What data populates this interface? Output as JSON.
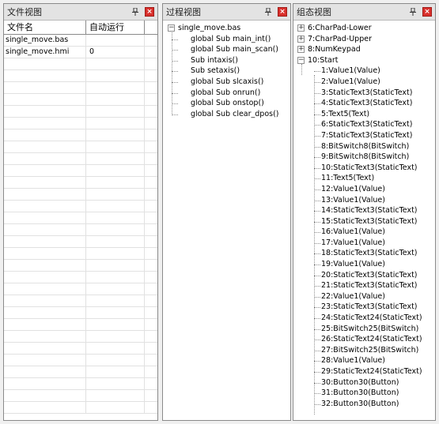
{
  "file_view": {
    "title": "文件视图",
    "columns": [
      "文件名",
      "自动运行"
    ],
    "rows": [
      {
        "name": "single_move.bas",
        "autorun": ""
      },
      {
        "name": "single_move.hmi",
        "autorun": "0"
      }
    ]
  },
  "process_view": {
    "title": "过程视图",
    "root": "single_move.bas",
    "items": [
      "global Sub main_int()",
      "global Sub main_scan()",
      "Sub intaxis()",
      "Sub setaxis()",
      "global Sub slcaxis()",
      "global Sub onrun()",
      "global Sub onstop()",
      "global Sub clear_dpos()"
    ]
  },
  "component_view": {
    "title": "组态视图",
    "collapsed": [
      "6:CharPad-Lower",
      "7:CharPad-Upper",
      "8:NumKeypad"
    ],
    "expanded_root": "10:Start",
    "children": [
      "1:Value1(Value)",
      "2:Value1(Value)",
      "3:StaticText3(StaticText)",
      "4:StaticText3(StaticText)",
      "5:Text5(Text)",
      "6:StaticText3(StaticText)",
      "7:StaticText3(StaticText)",
      "8:BitSwitch8(BitSwitch)",
      "9:BitSwitch8(BitSwitch)",
      "10:StaticText3(StaticText)",
      "11:Text5(Text)",
      "12:Value1(Value)",
      "13:Value1(Value)",
      "14:StaticText3(StaticText)",
      "15:StaticText3(StaticText)",
      "16:Value1(Value)",
      "17:Value1(Value)",
      "18:StaticText3(StaticText)",
      "19:Value1(Value)",
      "20:StaticText3(StaticText)",
      "21:StaticText3(StaticText)",
      "22:Value1(Value)",
      "23:StaticText3(StaticText)",
      "24:StaticText24(StaticText)",
      "25:BitSwitch25(BitSwitch)",
      "26:StaticText24(StaticText)",
      "27:BitSwitch25(BitSwitch)",
      "28:Value1(Value)",
      "29:StaticText24(StaticText)",
      "30:Button30(Button)",
      "31:Button30(Button)",
      "32:Button30(Button)"
    ]
  },
  "icons": {
    "pin": "pin-icon",
    "close": "close-icon",
    "expand": "plus",
    "collapse": "minus"
  },
  "colors": {
    "close_red": "#d9302c",
    "titlebar": "#e3e3e3",
    "background": "#f0f0f0"
  }
}
